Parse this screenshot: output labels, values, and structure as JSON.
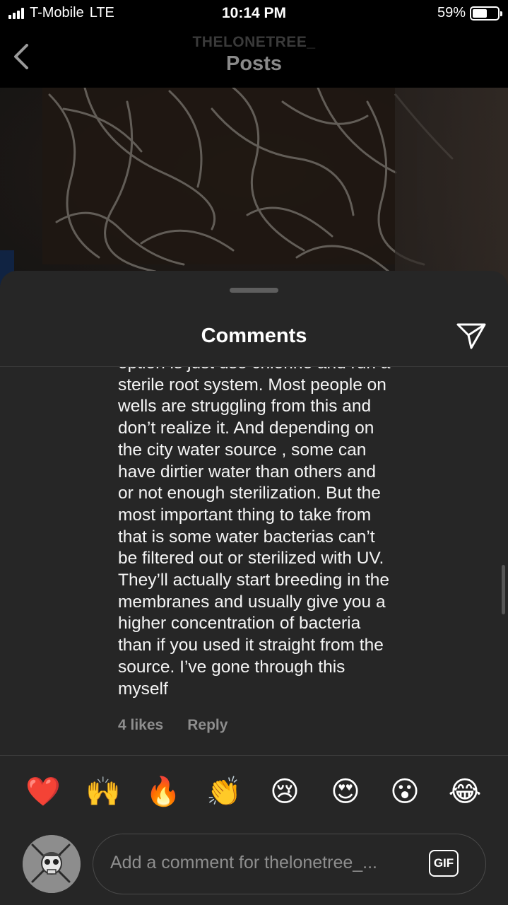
{
  "status_bar": {
    "carrier": "T-Mobile",
    "network": "LTE",
    "time": "10:14 PM",
    "battery": "59%",
    "battery_level": 0.59
  },
  "header": {
    "username": "THELONETREE_",
    "title": "Posts",
    "back_icon": "chevron-left-icon"
  },
  "comments_sheet": {
    "title": "Comments",
    "share_icon": "paper-plane-icon",
    "comment": {
      "text": "option is just use chlorine and run a\nsterile root system. Most people on\nwells are struggling from this and\ndon’t realize it. And depending on\nthe city water source , some can\nhave dirtier water than others and\nor not enough sterilization. But the\nmost important thing to take from\nthat is some water bacterias can’t\nbe filtered out or sterilized with UV.\nThey’ll actually start breeding in the\nmembranes and usually give you a\nhigher concentration of bacteria\nthan if you used it straight from the\nsource. I’ve gone through this\nmyself",
      "likes": "4 likes",
      "reply_label": "Reply"
    }
  },
  "emoji_bar": [
    "❤️",
    "🙌",
    "🔥",
    "👏",
    "😢",
    "😍",
    "😮",
    "😂"
  ],
  "composer": {
    "placeholder": "Add a comment for thelonetree_...",
    "gif_label": "GIF"
  }
}
